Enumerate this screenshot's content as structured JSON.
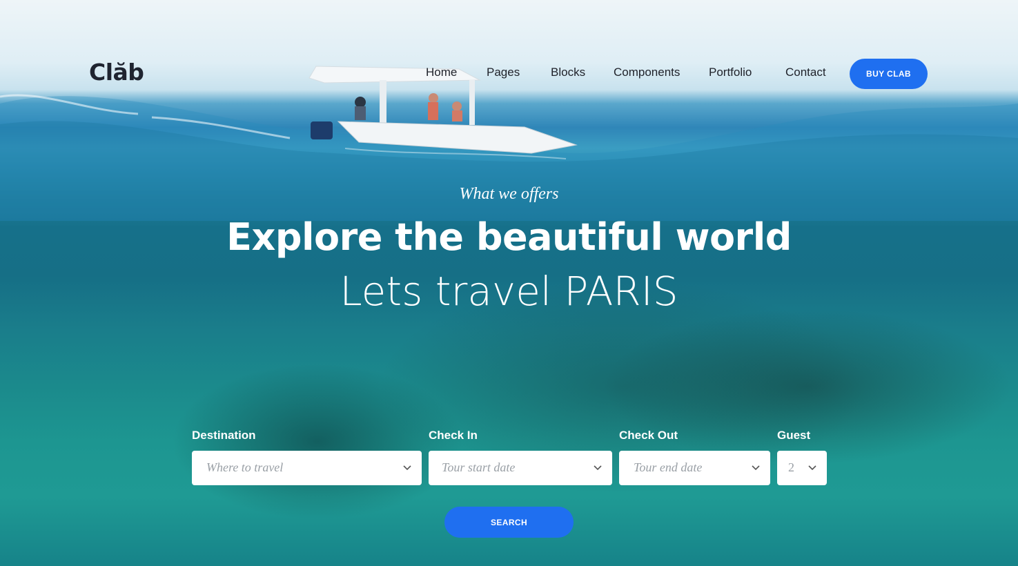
{
  "brand": {
    "logo_text": "Clăb"
  },
  "nav": {
    "items": [
      {
        "label": "Home"
      },
      {
        "label": "Pages"
      },
      {
        "label": "Blocks"
      },
      {
        "label": "Components"
      },
      {
        "label": "Portfolio"
      },
      {
        "label": "Contact"
      }
    ],
    "cta_label": "BUY CLAB"
  },
  "hero": {
    "eyebrow": "What we offers",
    "headline": "Explore the beautiful world",
    "subline": "Lets travel PARIS"
  },
  "search_form": {
    "destination": {
      "label": "Destination",
      "placeholder": "Where to travel"
    },
    "check_in": {
      "label": "Check In",
      "placeholder": "Tour start date"
    },
    "check_out": {
      "label": "Check Out",
      "placeholder": "Tour end date"
    },
    "guest": {
      "label": "Guest",
      "value": "2"
    },
    "search_label": "SEARCH"
  },
  "colors": {
    "accent": "#1f6ff0",
    "nav_text": "#20232b",
    "water": "#1d9691"
  },
  "icons": {
    "select_chevron": "chevron-down-icon"
  }
}
